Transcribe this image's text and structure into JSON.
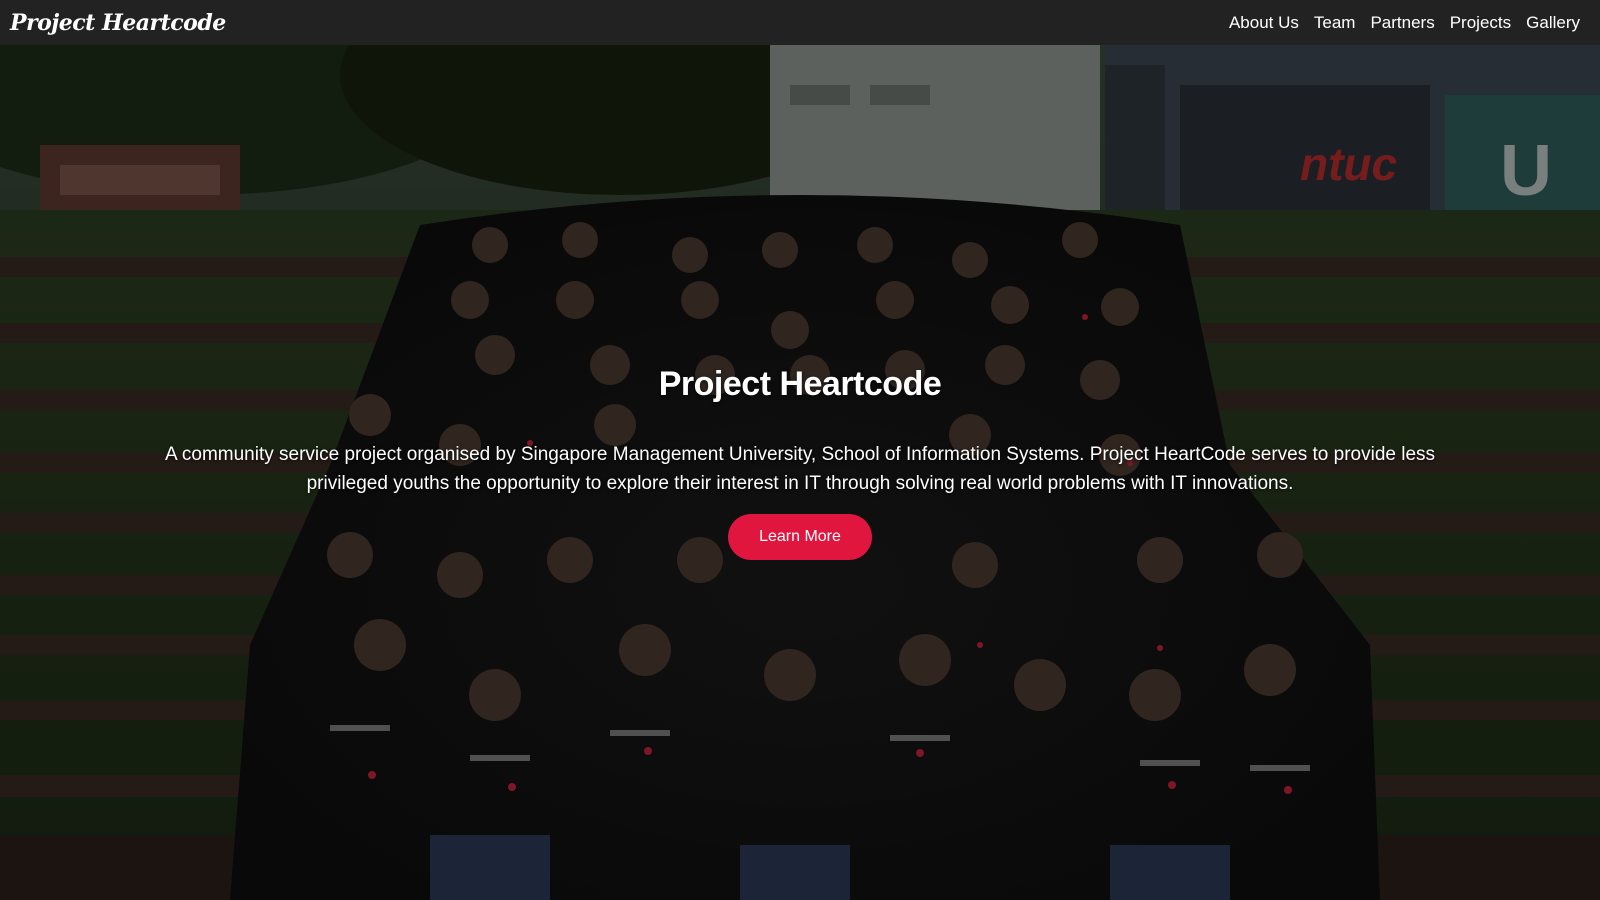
{
  "nav": {
    "brand": "Project Heartcode",
    "links": [
      "About Us",
      "Team",
      "Partners",
      "Projects",
      "Gallery"
    ]
  },
  "hero": {
    "title": "Project Heartcode",
    "description": "A community service project organised by Singapore Management University, School of Information Systems. Project HeartCode serves to provide less privileged youths the opportunity to explore their interest in IT through solving real world problems with IT innovations.",
    "button_label": "Learn More",
    "background_signs": [
      "ntuc",
      "U"
    ]
  },
  "colors": {
    "navbar": "#222222",
    "accent": "#e0163f",
    "text": "#ffffff"
  }
}
